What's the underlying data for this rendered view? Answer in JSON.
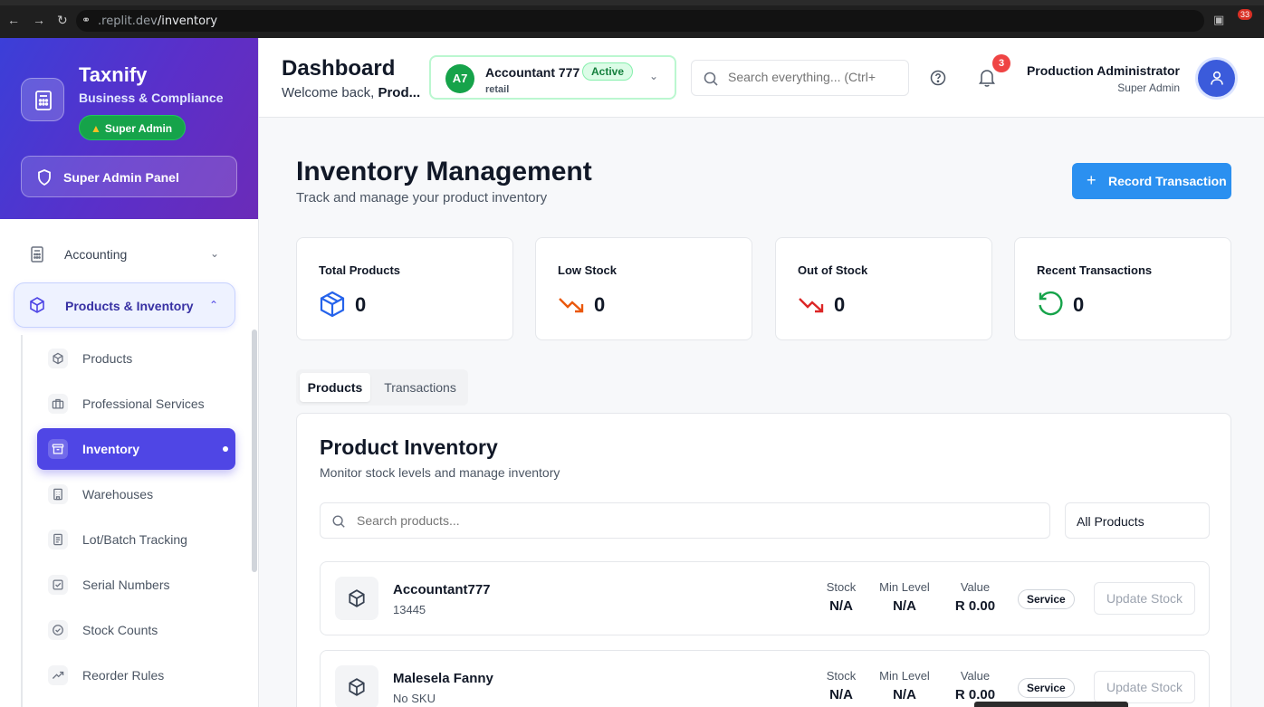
{
  "browser": {
    "url_prefix": ".replit.dev",
    "url_path": "/inventory",
    "ext_badge": "33"
  },
  "sidebar": {
    "brand": "Taxnify",
    "brand_sub": "Business & Compliance",
    "role_badge": "Super Admin",
    "panel_button": "Super Admin Panel",
    "sections": [
      {
        "label": "Accounting",
        "icon": "calculator-icon"
      },
      {
        "label": "Products & Inventory",
        "icon": "package-icon"
      }
    ],
    "sub_items": [
      {
        "label": "Products",
        "icon": "package-icon"
      },
      {
        "label": "Professional Services",
        "icon": "briefcase-icon"
      },
      {
        "label": "Inventory",
        "icon": "archive-icon"
      },
      {
        "label": "Warehouses",
        "icon": "building-icon"
      },
      {
        "label": "Lot/Batch Tracking",
        "icon": "file-text-icon"
      },
      {
        "label": "Serial Numbers",
        "icon": "check-square-icon"
      },
      {
        "label": "Stock Counts",
        "icon": "check-circle-icon"
      },
      {
        "label": "Reorder Rules",
        "icon": "trending-up-icon"
      }
    ]
  },
  "header": {
    "title": "Dashboard",
    "welcome_prefix": "Welcome back, ",
    "welcome_name": "Prod...",
    "account": {
      "initials": "A7",
      "name": "Accountant 777",
      "status": "Active",
      "type": "retail"
    },
    "search_placeholder": "Search everything... (Ctrl+",
    "notifications": "3",
    "user_name": "Production Administrator",
    "user_role": "Super Admin"
  },
  "main": {
    "title": "Inventory Management",
    "subtitle": "Track and manage your product inventory",
    "record_button": "Record Transaction",
    "stats": [
      {
        "label": "Total Products",
        "value": "0",
        "icon": "package-icon",
        "color": "#2563eb"
      },
      {
        "label": "Low Stock",
        "value": "0",
        "icon": "trending-down-icon",
        "color": "#ea580c"
      },
      {
        "label": "Out of Stock",
        "value": "0",
        "icon": "trending-down-icon",
        "color": "#dc2626"
      },
      {
        "label": "Recent Transactions",
        "value": "0",
        "icon": "refresh-icon",
        "color": "#16a34a"
      }
    ],
    "tabs": [
      "Products",
      "Transactions"
    ],
    "inventory": {
      "title": "Product Inventory",
      "subtitle": "Monitor stock levels and manage inventory",
      "search_placeholder": "Search products...",
      "filter": "All Products",
      "col_stock": "Stock",
      "col_min": "Min Level",
      "col_value": "Value",
      "rows": [
        {
          "name": "Accountant777",
          "sku": "13445",
          "stock": "N/A",
          "min": "N/A",
          "value": "R 0.00",
          "type": "Service",
          "action": "Update Stock"
        },
        {
          "name": "Malesela Fanny",
          "sku": "No SKU",
          "stock": "N/A",
          "min": "N/A",
          "value": "R 0.00",
          "type": "Service",
          "action": "Update Stock"
        }
      ]
    }
  },
  "colors": {
    "accent": "#4f46e5",
    "primary_button": "#2b90f0",
    "success": "#16a34a"
  }
}
